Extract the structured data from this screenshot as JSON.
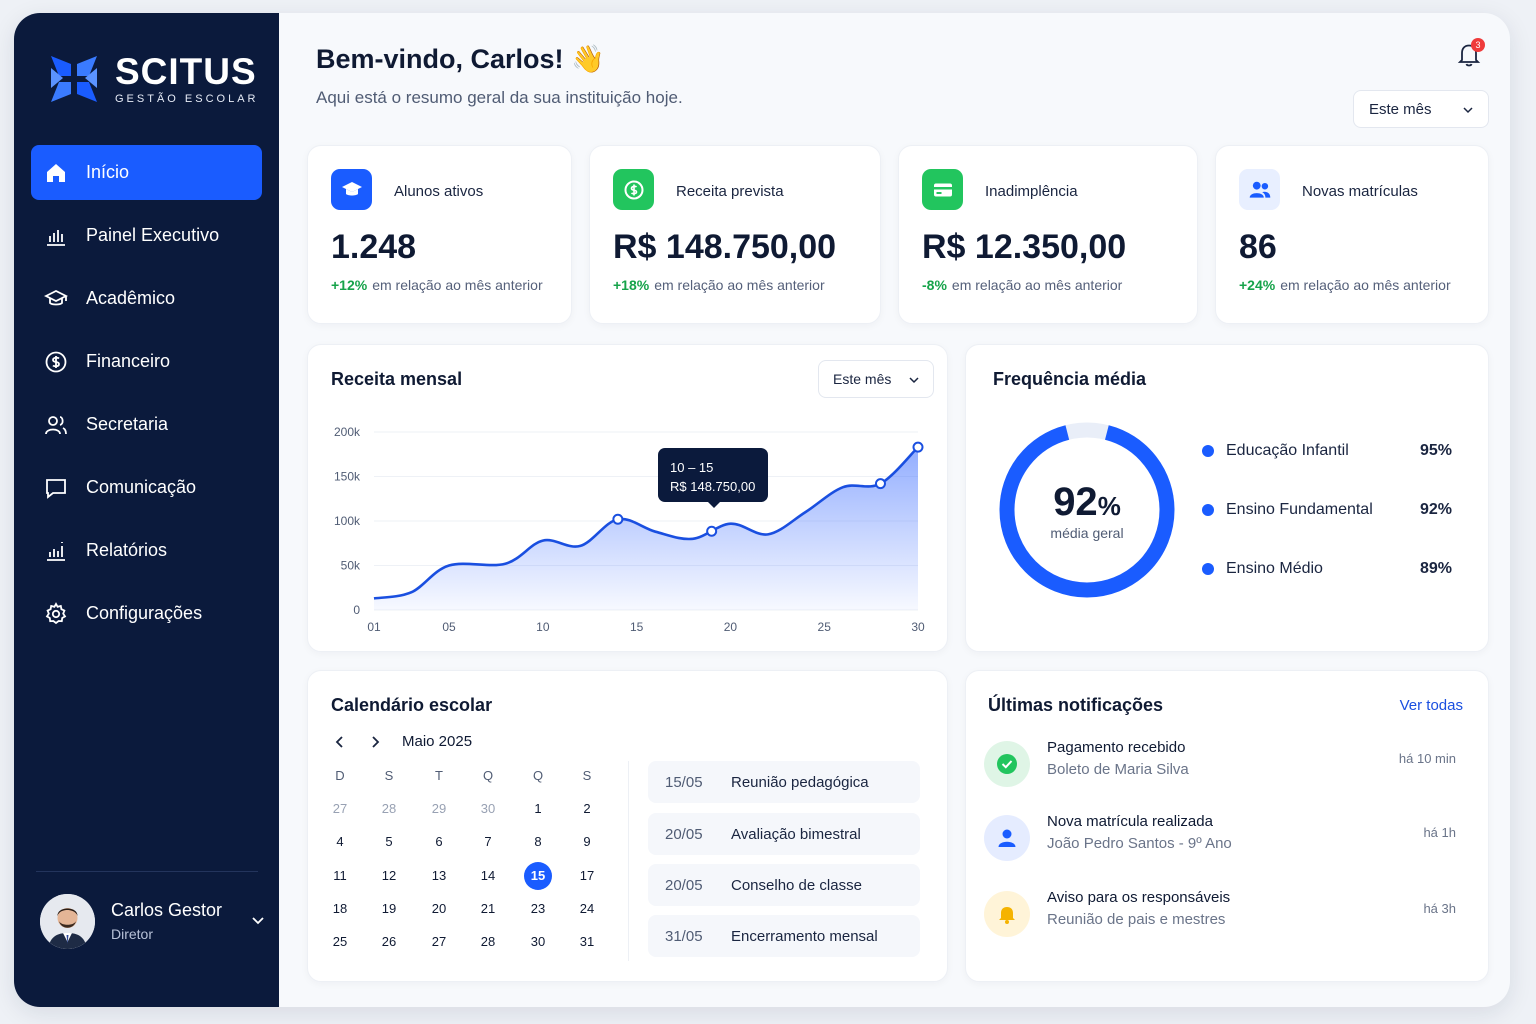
{
  "brand": {
    "name": "SCITUS",
    "tagline": "GESTÃO ESCOLAR"
  },
  "sidebar": {
    "items": [
      {
        "label": "Início",
        "icon": "home-icon",
        "active": true
      },
      {
        "label": "Painel Executivo",
        "icon": "bar-chart-icon"
      },
      {
        "label": "Acadêmico",
        "icon": "graduation-cap-icon"
      },
      {
        "label": "Financeiro",
        "icon": "dollar-circle-icon"
      },
      {
        "label": "Secretaria",
        "icon": "users-icon"
      },
      {
        "label": "Comunicação",
        "icon": "chat-icon"
      },
      {
        "label": "Relatórios",
        "icon": "report-icon"
      },
      {
        "label": "Configurações",
        "icon": "gear-icon"
      }
    ],
    "user": {
      "name": "Carlos Gestor",
      "role": "Diretor"
    }
  },
  "header": {
    "greeting": "Bem-vindo, Carlos! 👋",
    "subtitle": "Aqui está o resumo geral da sua instituição hoje.",
    "notification_count": "3",
    "period": "Este mês"
  },
  "kpis": [
    {
      "label": "Alunos ativos",
      "value": "1.248",
      "delta": "+12%",
      "delta_text": "em relação ao mês anterior",
      "delta_color": "#16a34a",
      "icon": "graduation-cap-icon",
      "icon_bg": "#1a5cff"
    },
    {
      "label": "Receita prevista",
      "value": "R$ 148.750,00",
      "delta": "+18%",
      "delta_text": "em relação ao mês anterior",
      "delta_color": "#16a34a",
      "icon": "money-icon",
      "icon_bg": "#22c55e"
    },
    {
      "label": "Inadimplência",
      "value": "R$ 12.350,00",
      "delta": "-8%",
      "delta_text": "em relação ao mês anterior",
      "delta_color": "#16a34a",
      "icon": "card-icon",
      "icon_bg": "#22c55e"
    },
    {
      "label": "Novas matrículas",
      "value": "86",
      "delta": "+24%",
      "delta_text": "em relação ao mês anterior",
      "delta_color": "#16a34a",
      "icon": "users-icon",
      "icon_bg": "#e8efff"
    }
  ],
  "revenue": {
    "title": "Receita mensal",
    "period": "Este mês",
    "tooltip_range": "10 – 15",
    "tooltip_value": "R$ 148.750,00"
  },
  "chart_data": {
    "type": "area",
    "title": "Receita mensal",
    "x": [
      1,
      3,
      5,
      8,
      10,
      12,
      14,
      16,
      18,
      20,
      22,
      24,
      26,
      28,
      30
    ],
    "y": [
      13000,
      20000,
      50000,
      52000,
      78000,
      72000,
      102000,
      88000,
      80000,
      97000,
      85000,
      110000,
      138000,
      142000,
      183000
    ],
    "marked_points": [
      14,
      19,
      28,
      30
    ],
    "xticks": [
      "01",
      "05",
      "10",
      "15",
      "20",
      "25",
      "30"
    ],
    "yticks": [
      "0",
      "50k",
      "100k",
      "150k",
      "200k"
    ],
    "xlim": [
      1,
      30
    ],
    "ylim": [
      0,
      200000
    ],
    "color": "#1a4fe0"
  },
  "frequency": {
    "title": "Frequência média",
    "value": "92",
    "unit": "%",
    "caption": "média geral",
    "percent": 92,
    "items": [
      {
        "label": "Educação Infantil",
        "pct": "95%"
      },
      {
        "label": "Ensino Fundamental",
        "pct": "92%"
      },
      {
        "label": "Ensino Médio",
        "pct": "89%"
      }
    ]
  },
  "calendar": {
    "title": "Calendário escolar",
    "month": "Maio 2025",
    "weekdays": [
      "D",
      "S",
      "T",
      "Q",
      "Q",
      "S"
    ],
    "weeks": [
      [
        "27",
        "28",
        "29",
        "30",
        "1",
        "2"
      ],
      [
        "4",
        "5",
        "6",
        "7",
        "8",
        "9"
      ],
      [
        "11",
        "12",
        "13",
        "14",
        "15",
        "17"
      ],
      [
        "18",
        "19",
        "20",
        "21",
        "23",
        "24"
      ],
      [
        "25",
        "26",
        "27",
        "28",
        "30",
        "31"
      ]
    ],
    "events": [
      {
        "date": "15/05",
        "label": "Reunião pedagógica"
      },
      {
        "date": "20/05",
        "label": "Avaliação bimestral"
      },
      {
        "date": "20/05",
        "label": "Conselho de classe"
      },
      {
        "date": "31/05",
        "label": "Encerramento mensal"
      }
    ]
  },
  "notifications": {
    "title": "Últimas notificações",
    "see_all": "Ver todas",
    "items": [
      {
        "title": "Pagamento recebido",
        "sub": "Boleto de Maria Silva",
        "time": "há 10 min",
        "icon": "check-icon"
      },
      {
        "title": "Nova matrícula realizada",
        "sub": "João Pedro Santos - 9º Ano",
        "time": "há 1h",
        "icon": "user-icon"
      },
      {
        "title": "Aviso para os responsáveis",
        "sub": "Reunião de pais e mestres",
        "time": "há 3h",
        "icon": "bell-icon"
      }
    ]
  }
}
